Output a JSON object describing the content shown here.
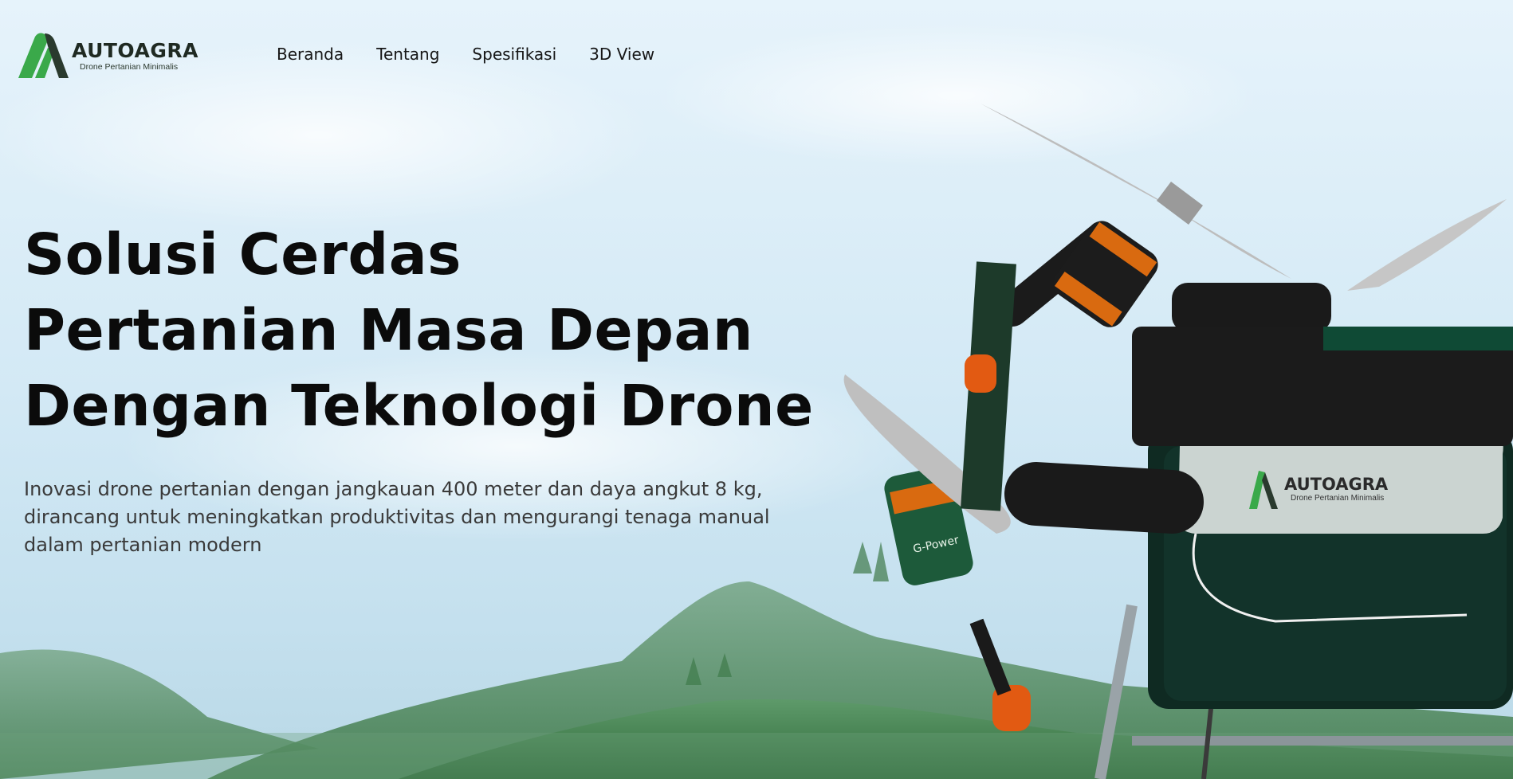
{
  "brand": {
    "name": "AUTOAGRA",
    "tagline": "Drone Pertanian Minimalis",
    "accent_color": "#3aa94a",
    "dark_color": "#1f2a22"
  },
  "nav": {
    "items": [
      {
        "label": "Beranda"
      },
      {
        "label": "Tentang"
      },
      {
        "label": "Spesifikasi"
      },
      {
        "label": "3D View"
      }
    ]
  },
  "hero": {
    "title_lines": [
      "Solusi Cerdas",
      "Pertanian Masa Depan",
      "Dengan Teknologi Drone"
    ],
    "description": "Inovasi drone pertanian dengan jangkauan 400 meter dan daya angkut 8 kg, dirancang untuk meningkatkan produktivitas dan mengurangi tenaga manual dalam pertanian modern"
  },
  "drone_image": {
    "icon": "agricultural-drone-photo",
    "body_logo_name": "AUTOAGRA",
    "body_logo_tagline": "Drone Pertanian Minimalis",
    "motor_label": "G-Power"
  }
}
